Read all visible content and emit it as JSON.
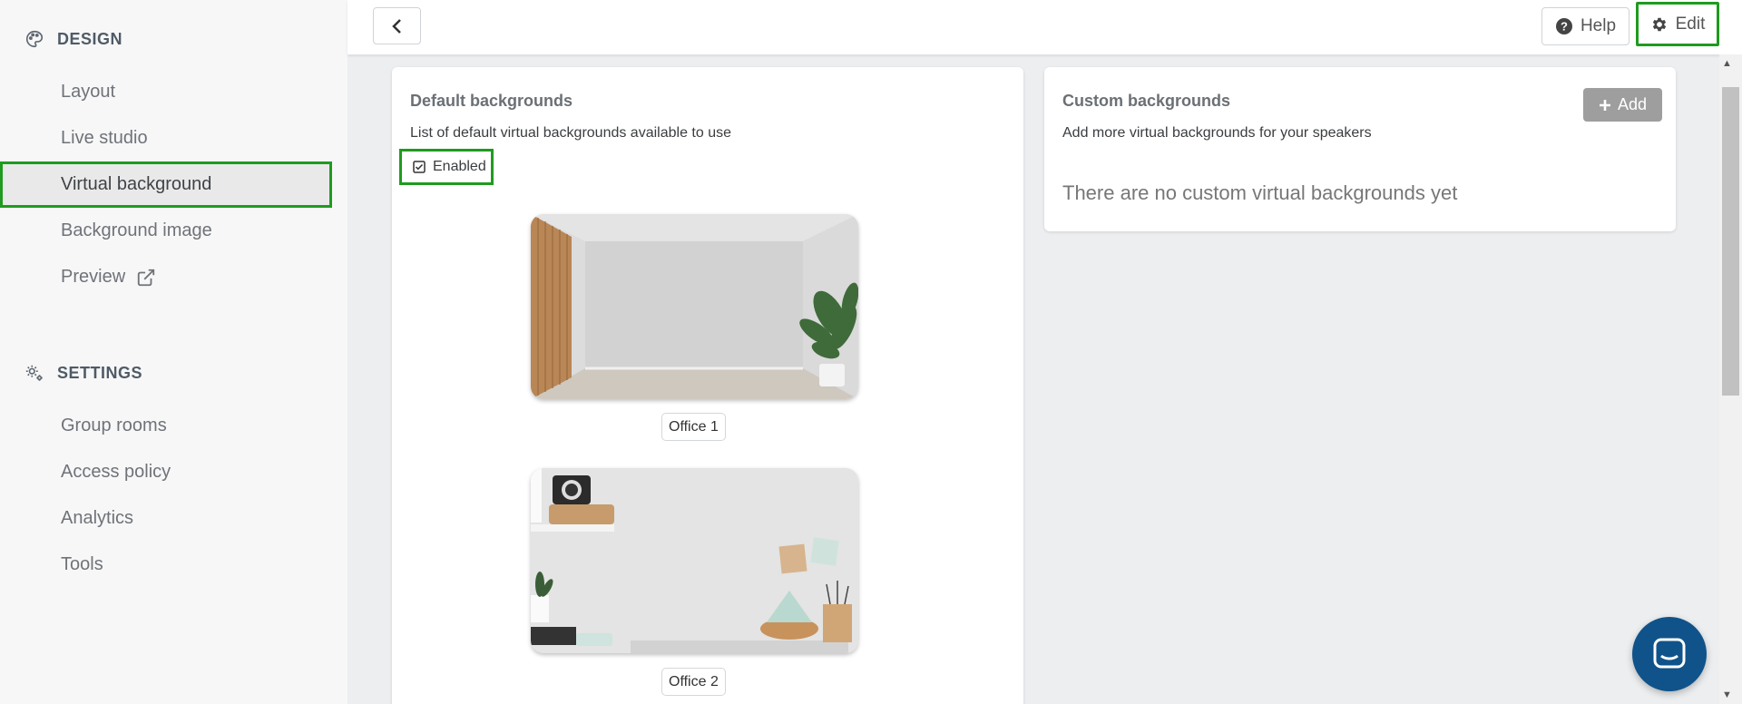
{
  "sidebar": {
    "design_heading": "DESIGN",
    "design_items": [
      {
        "label": "Layout"
      },
      {
        "label": "Live studio"
      },
      {
        "label": "Virtual background"
      },
      {
        "label": "Background image"
      },
      {
        "label": "Preview"
      }
    ],
    "settings_heading": "SETTINGS",
    "settings_items": [
      {
        "label": "Group rooms"
      },
      {
        "label": "Access policy"
      },
      {
        "label": "Analytics"
      },
      {
        "label": "Tools"
      }
    ]
  },
  "topbar": {
    "help_label": "Help",
    "edit_label": "Edit"
  },
  "default_backgrounds": {
    "title": "Default backgrounds",
    "description": "List of default virtual backgrounds available to use",
    "enabled_label": "Enabled",
    "items": [
      {
        "label": "Office 1"
      },
      {
        "label": "Office 2"
      }
    ]
  },
  "custom_backgrounds": {
    "title": "Custom backgrounds",
    "add_label": "Add",
    "description": "Add more virtual backgrounds for your speakers",
    "empty_text": "There are no custom virtual backgrounds yet"
  },
  "colors": {
    "highlight": "#1f9b1f",
    "chat_button": "#10538a"
  },
  "icons": [
    "palette-icon",
    "settings-gears-icon",
    "external-link-icon",
    "chevron-left-icon",
    "help-circle-icon",
    "gear-icon",
    "plus-icon",
    "checkbox-checked-icon",
    "chat-icon"
  ]
}
